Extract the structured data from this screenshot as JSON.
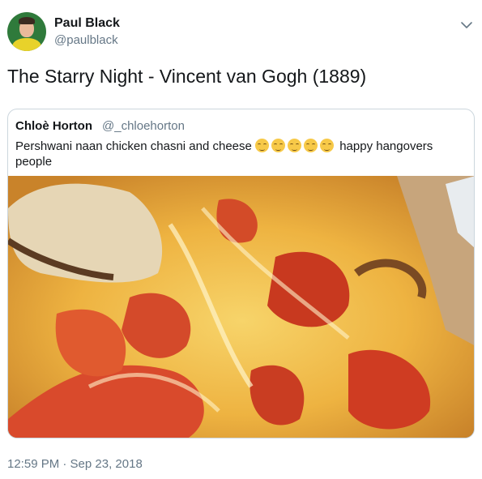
{
  "author": {
    "name": "Paul Black",
    "handle": "@paulblack",
    "avatar_icon": "avatar-person"
  },
  "tweet": {
    "text": "The Starry Night - Vincent van Gogh (1889)",
    "timestamp": "12:59 PM · Sep 23, 2018",
    "menu_icon": "chevron-down-icon"
  },
  "quoted": {
    "name": "Chloè Horton",
    "handle": "@_chloehorton",
    "text_before": "Pershwani naan chicken chasni and cheese",
    "emoji_count": 5,
    "emoji_icon": "relieved-face-emoji",
    "text_after": "happy hangovers people",
    "photo_icon": "pizza-photo"
  },
  "colors": {
    "text": "#14171a",
    "secondary": "#657786",
    "border": "#ccd6dd"
  }
}
